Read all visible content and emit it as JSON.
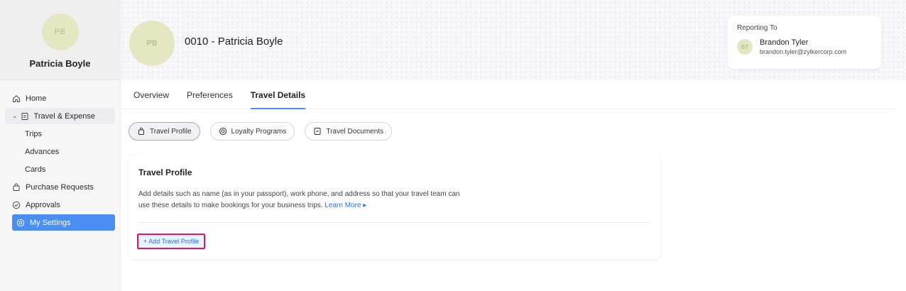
{
  "user": {
    "initials": "PB",
    "name": "Patricia Boyle"
  },
  "sidebar": {
    "items": [
      {
        "label": "Home",
        "icon": "home-icon"
      },
      {
        "label": "Travel & Expense",
        "icon": "document-icon"
      },
      {
        "label": "Trips"
      },
      {
        "label": "Advances"
      },
      {
        "label": "Cards"
      },
      {
        "label": "Purchase Requests",
        "icon": "bag-icon"
      },
      {
        "label": "Approvals",
        "icon": "check-circle-icon"
      },
      {
        "label": "My Settings",
        "icon": "gear-icon"
      }
    ]
  },
  "header": {
    "initials": "PB",
    "title": "0010 - Patricia Boyle",
    "reporting": {
      "label": "Reporting To",
      "initials": "BT",
      "name": "Brandon Tyler",
      "email": "brandon.tyler@zylkercorp.com"
    }
  },
  "tabs": [
    {
      "label": "Overview"
    },
    {
      "label": "Preferences"
    },
    {
      "label": "Travel Details",
      "active": true
    }
  ],
  "pills": [
    {
      "label": "Travel Profile",
      "icon": "bag-icon",
      "active": true
    },
    {
      "label": "Loyalty Programs",
      "icon": "target-icon"
    },
    {
      "label": "Travel Documents",
      "icon": "document-icon"
    }
  ],
  "card": {
    "title": "Travel Profile",
    "description": "Add details such as name (as in your passport), work phone, and address so that your travel team can use these details to make bookings for your business trips.",
    "learn_more": "Learn More ▸",
    "add_button": "+ Add Travel Profile"
  },
  "colors": {
    "accent": "#4a8ef4",
    "link": "#2a73e8",
    "highlight": "#e8175d",
    "avatar": "#e3e8c3"
  }
}
